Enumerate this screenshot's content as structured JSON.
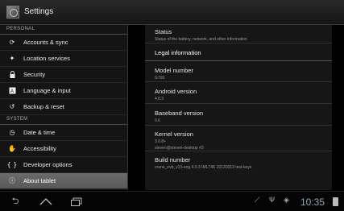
{
  "app": {
    "title": "Settings"
  },
  "sidebar": {
    "section_personal": "PERSONAL",
    "section_system": "SYSTEM",
    "personal_items": [
      {
        "label": "Accounts & sync",
        "icon": "sync-icon"
      },
      {
        "label": "Location services",
        "icon": "location-icon"
      },
      {
        "label": "Security",
        "icon": "lock-icon"
      },
      {
        "label": "Language & input",
        "icon": "language-icon"
      },
      {
        "label": "Backup & reset",
        "icon": "backup-icon"
      }
    ],
    "system_items": [
      {
        "label": "Date & time",
        "icon": "clock-icon"
      },
      {
        "label": "Accessibility",
        "icon": "hand-icon"
      },
      {
        "label": "Developer options",
        "icon": "braces-icon"
      },
      {
        "label": "About tablet",
        "icon": "info-icon",
        "selected": true
      }
    ]
  },
  "about": {
    "status_title": "Status",
    "status_sub": "Status of the battery, network, and other information",
    "legal_title": "Legal information",
    "model_title": "Model number",
    "model_value": "G700",
    "android_title": "Android version",
    "android_value": "4.0.3",
    "baseband_title": "Baseband version",
    "baseband_value": "0.6",
    "kernel_title": "Kernel version",
    "kernel_value1": "3.0.8+",
    "kernel_value2": "steven@steven-desktop #3",
    "build_title": "Build number",
    "build_value": "crane_evb_v13-eng 4.0.3 IML74K 20120313 test-keys"
  },
  "statusbar": {
    "time": "10:35"
  },
  "colors": {
    "selected_bg": "#636363",
    "clock": "#8fa8b8"
  }
}
